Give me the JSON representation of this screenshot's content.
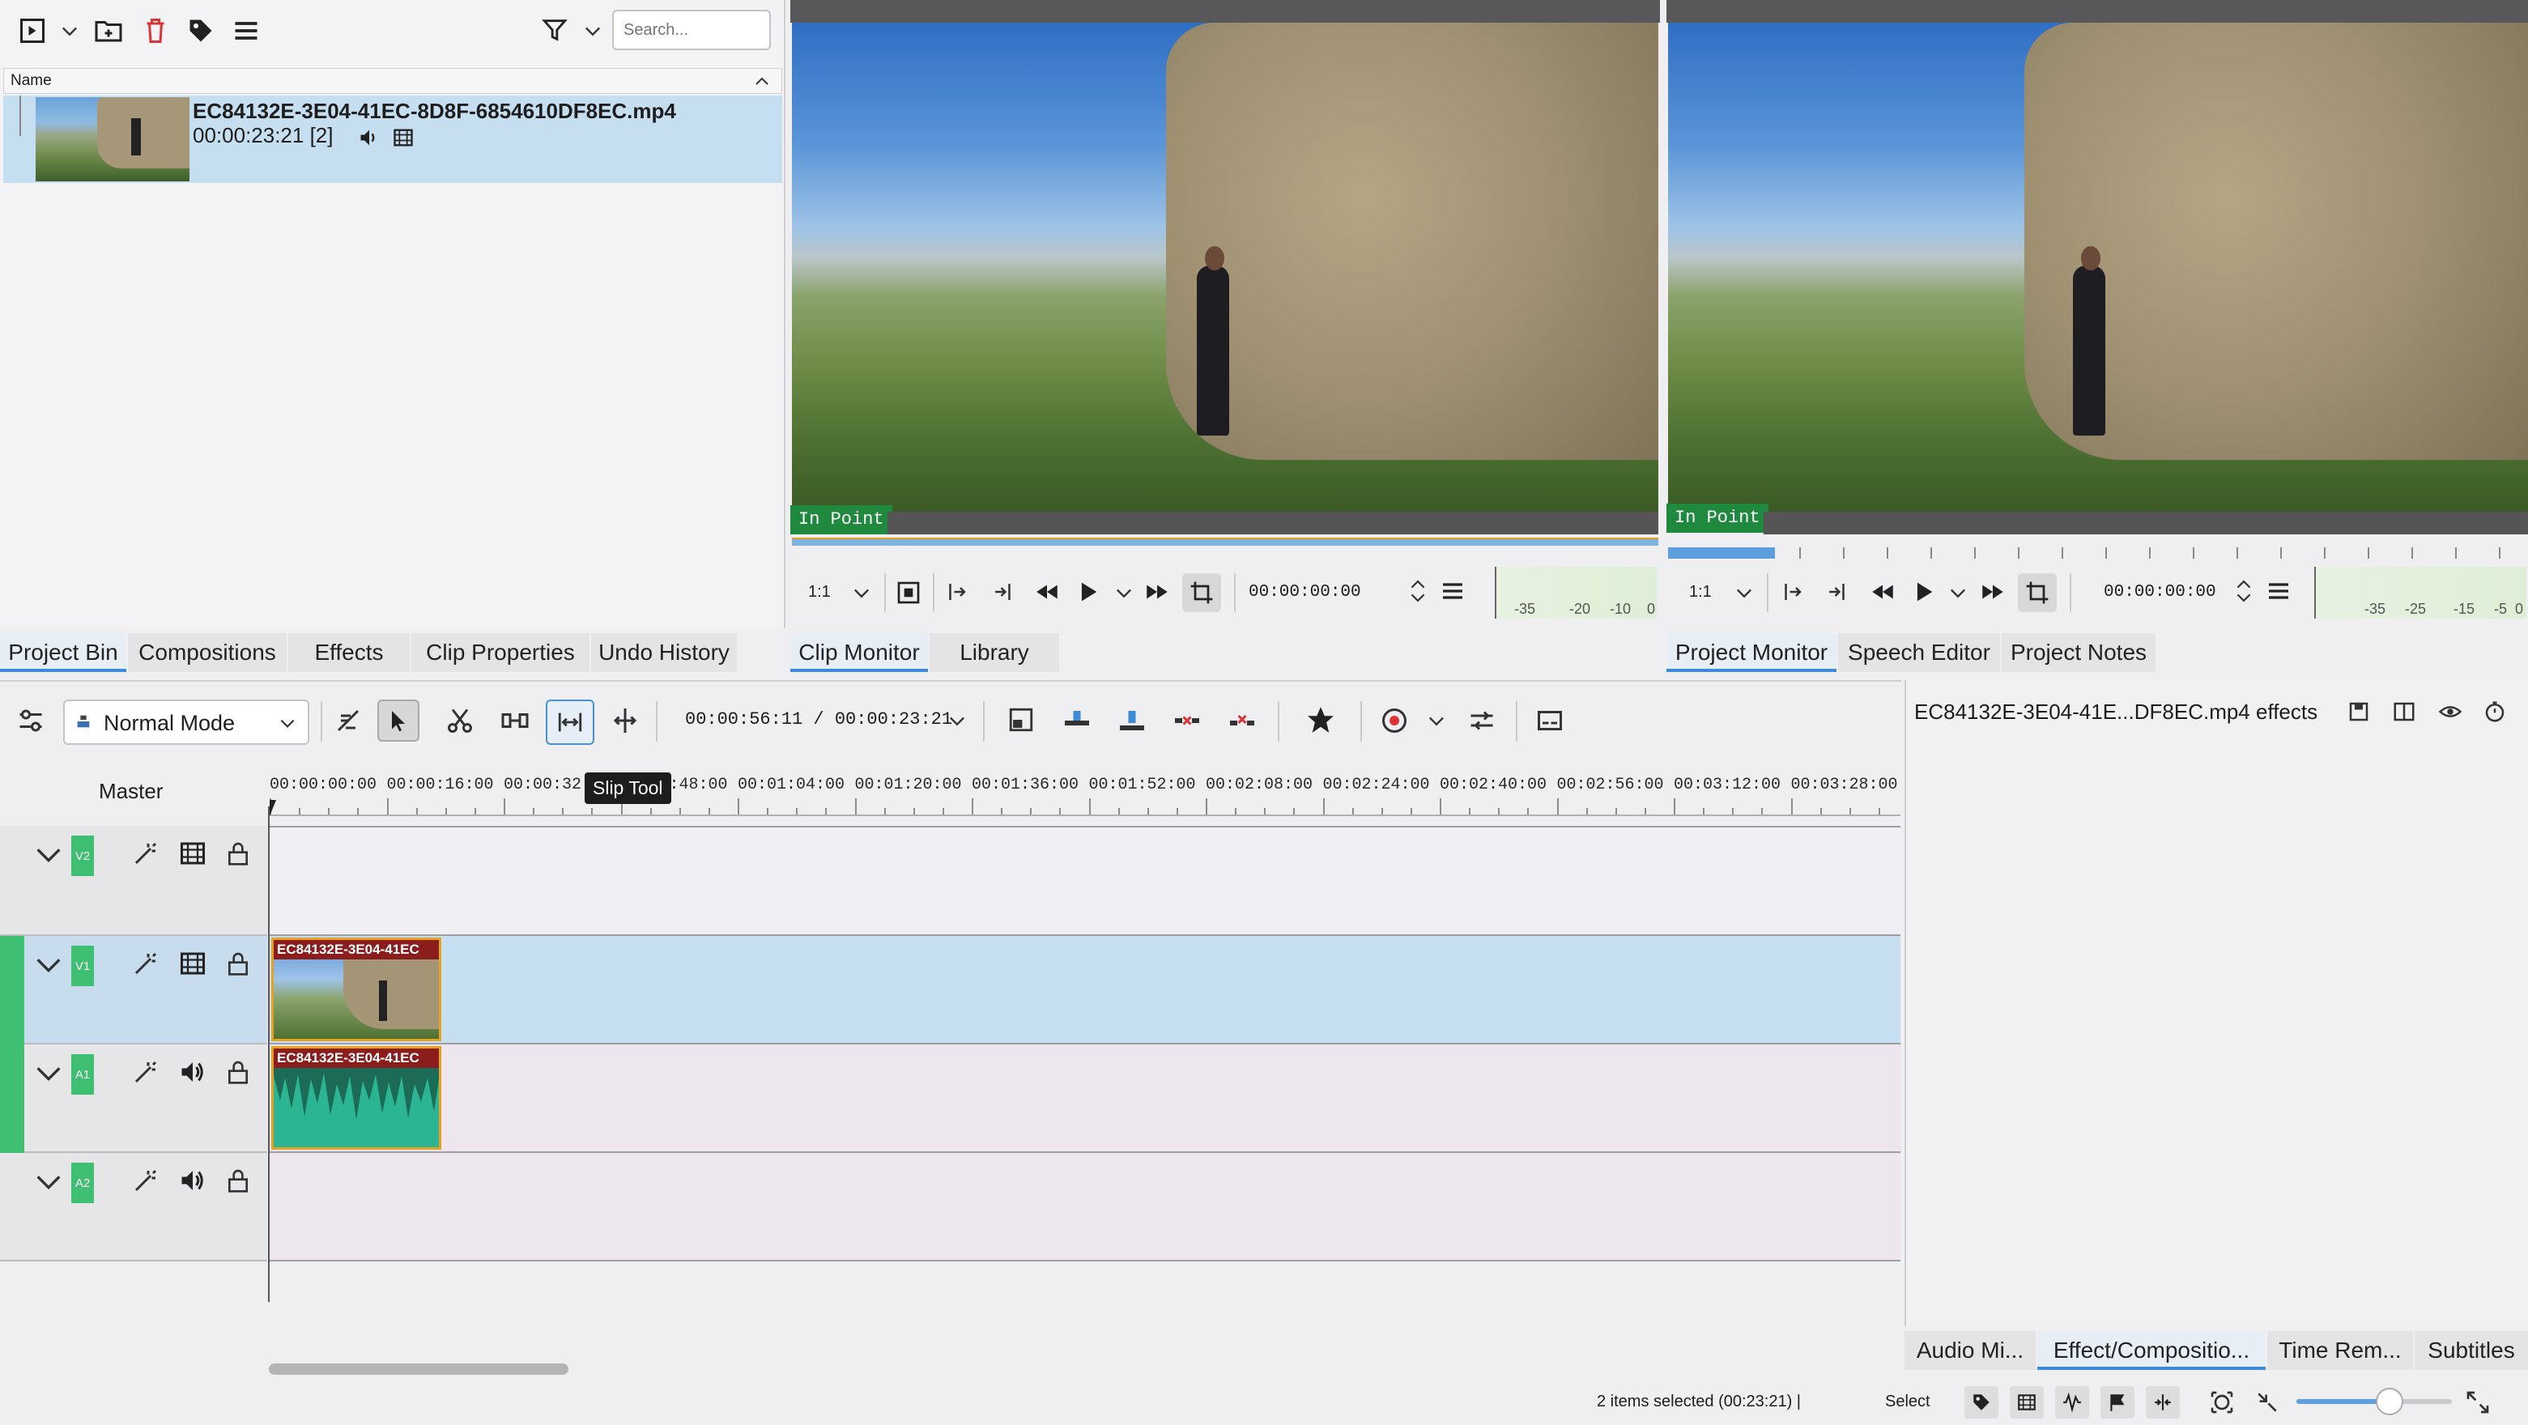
{
  "bin": {
    "search_placeholder": "Search...",
    "column_name": "Name",
    "clip": {
      "name": "EC84132E-3E04-41EC-8D8F-6854610DF8EC.mp4",
      "duration": "00:00:23:21 [2]"
    }
  },
  "left_tabs": [
    "Project Bin",
    "Compositions",
    "Effects",
    "Clip Properties",
    "Undo History"
  ],
  "clip_monitor": {
    "in_point": "In Point",
    "zoom": "1:1",
    "timecode": "00:00:00:00",
    "meter_labels": [
      "-35",
      "-20",
      "-10",
      "0"
    ],
    "tabs": [
      "Clip Monitor",
      "Library"
    ]
  },
  "project_monitor": {
    "in_point": "In Point",
    "zoom": "1:1",
    "timecode": "00:00:00:00",
    "meter_labels": [
      "-35",
      "-25",
      "-15",
      "-5",
      "0"
    ],
    "tabs": [
      "Project Monitor",
      "Speech Editor",
      "Project Notes"
    ]
  },
  "timeline_toolbar": {
    "mode": "Normal Mode",
    "timecode": "00:00:56:11 / 00:00:23:21",
    "tooltip": "Slip Tool"
  },
  "timeline": {
    "master_label": "Master",
    "ruler": [
      "00:00:00:00",
      "00:00:16:00",
      "00:00:32:00",
      "00:00:48:00",
      "00:01:04:00",
      "00:01:20:00",
      "00:01:36:00",
      "00:01:52:00",
      "00:02:08:00",
      "00:02:24:00",
      "00:02:40:00",
      "00:02:56:00",
      "00:03:12:00",
      "00:03:28:00"
    ],
    "tracks": [
      {
        "id": "V2",
        "type": "video"
      },
      {
        "id": "V1",
        "type": "video"
      },
      {
        "id": "A1",
        "type": "audio"
      },
      {
        "id": "A2",
        "type": "audio"
      }
    ],
    "clip_label": "EC84132E-3E04-41EC"
  },
  "effects_panel": {
    "title": "EC84132E-3E04-41E...DF8EC.mp4 effects"
  },
  "bottom_tabs": [
    "Audio Mi...",
    "Effect/Compositio...",
    "Time Rem...",
    "Subtitles"
  ],
  "status": {
    "selection": "2 items selected (00:23:21) |",
    "tool": "Select"
  },
  "colors": {
    "accent": "#3d8ad8",
    "track_green": "#3fbf72",
    "clip_red": "#8b1d1d",
    "audio_teal": "#2bb592",
    "selection_blue": "#c6dff0"
  }
}
